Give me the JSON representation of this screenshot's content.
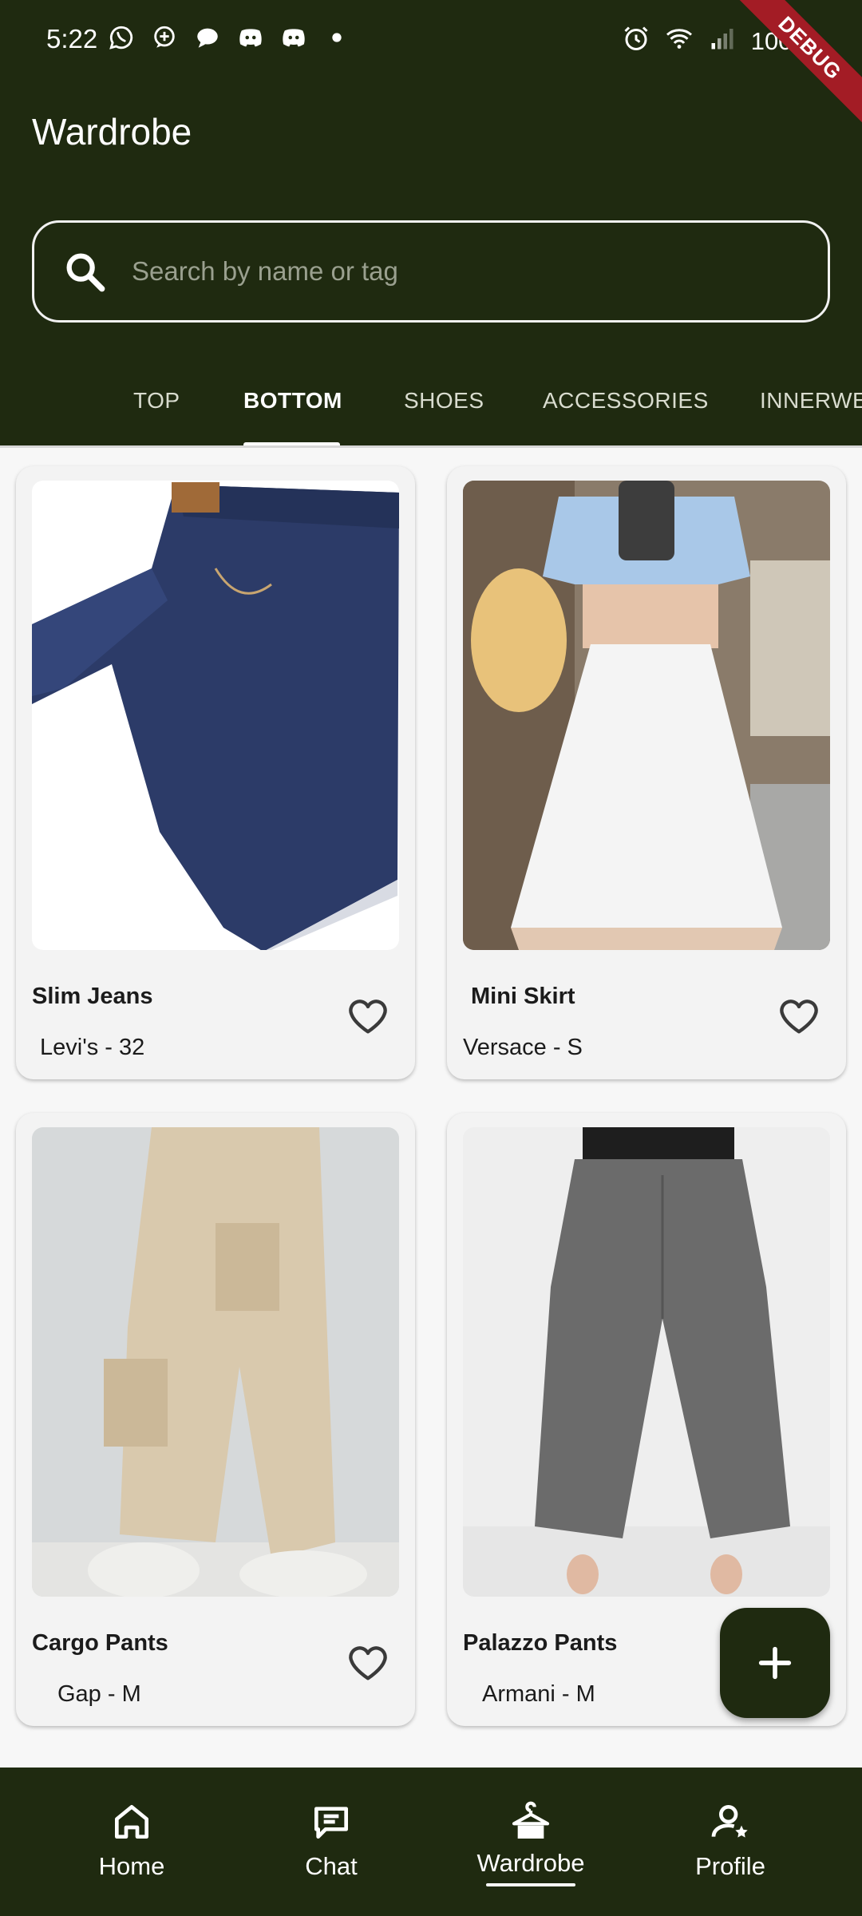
{
  "status_bar": {
    "time": "5:22",
    "battery": "100%",
    "notification_icons": [
      "whatsapp-icon",
      "message-plus-icon",
      "chat-bubble-icon",
      "discord-icon",
      "discord-icon",
      "dot-icon"
    ],
    "right_icons": [
      "alarm-icon",
      "wifi-icon",
      "signal-icon"
    ]
  },
  "debug_banner": "DEBUG",
  "header": {
    "title": "Wardrobe"
  },
  "search": {
    "placeholder": "Search by name or tag",
    "value": ""
  },
  "tabs": [
    {
      "label": "TOP",
      "active": false
    },
    {
      "label": "BOTTOM",
      "active": true
    },
    {
      "label": "SHOES",
      "active": false
    },
    {
      "label": "ACCESSORIES",
      "active": false
    },
    {
      "label": "INNERWE",
      "active": false
    }
  ],
  "items": [
    {
      "name": "Slim Jeans",
      "meta": "Levi's - 32",
      "image": "blue-jeans-photo",
      "favorite": false
    },
    {
      "name": "Mini Skirt",
      "meta": "Versace - S",
      "image": "white-mini-skirt-photo",
      "favorite": false
    },
    {
      "name": "Cargo Pants",
      "meta": "Gap - M",
      "image": "beige-cargo-pants-photo",
      "favorite": false
    },
    {
      "name": "Palazzo Pants",
      "meta": "Armani - M",
      "image": "grey-palazzo-pants-photo",
      "favorite": false
    }
  ],
  "fab": {
    "icon": "plus-icon"
  },
  "bottom_nav": [
    {
      "label": "Home",
      "icon": "home-icon",
      "active": false
    },
    {
      "label": "Chat",
      "icon": "chat-icon",
      "active": false
    },
    {
      "label": "Wardrobe",
      "icon": "hanger-icon",
      "active": true
    },
    {
      "label": "Profile",
      "icon": "profile-icon",
      "active": false
    }
  ],
  "colors": {
    "primary_dark": "#1f2a10",
    "background": "#f7f7f7",
    "card": "#f3f3f3",
    "debug_red": "#a31c25"
  }
}
